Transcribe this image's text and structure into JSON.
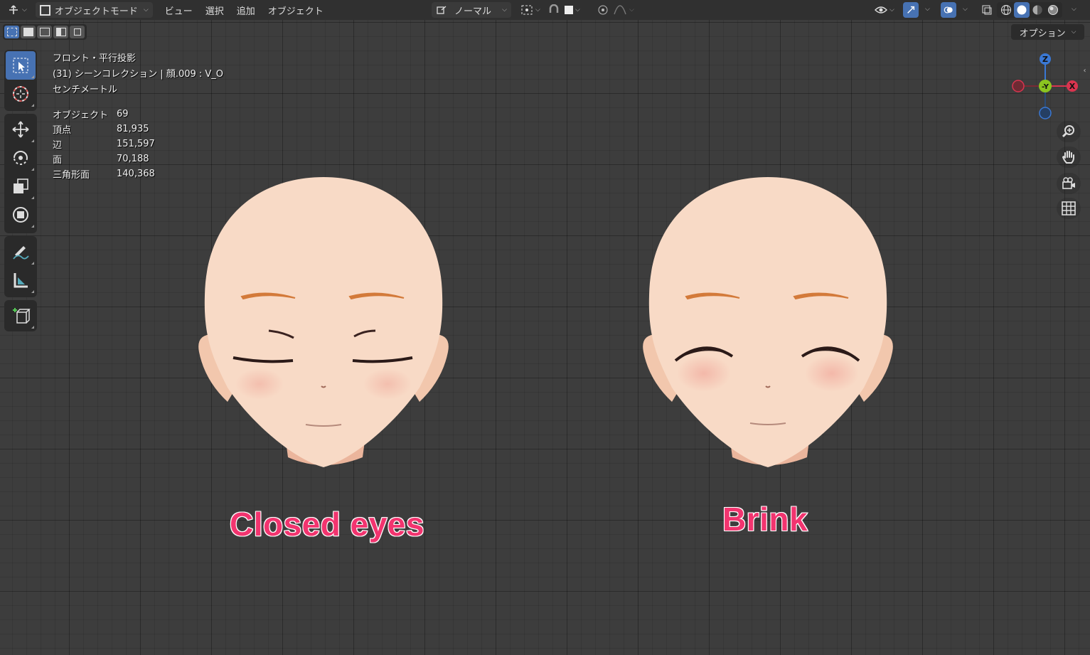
{
  "header": {
    "mode_label": "オブジェクトモード",
    "menus": [
      "ビュー",
      "選択",
      "追加",
      "オブジェクト"
    ],
    "orientation_label": "ノーマル"
  },
  "toolbar": {
    "options_label": "オプション"
  },
  "overlay": {
    "view_name": "フロント・平行投影",
    "collection": "(31) シーンコレクション | 顔.009 : V_O",
    "units": "センチメートル"
  },
  "stats": [
    {
      "label": "オブジェクト",
      "value": "69"
    },
    {
      "label": "頂点",
      "value": "81,935"
    },
    {
      "label": "辺",
      "value": "151,597"
    },
    {
      "label": "面",
      "value": "70,188"
    },
    {
      "label": "三角形面",
      "value": "140,368"
    }
  ],
  "gizmo": {
    "z": "Z",
    "y": "-Y",
    "x": "X"
  },
  "captions": {
    "left": "Closed eyes",
    "right": "Brink"
  },
  "colors": {
    "accent": "#4772b3",
    "caption": "#f2346f",
    "skin": "#f6d6c0"
  }
}
